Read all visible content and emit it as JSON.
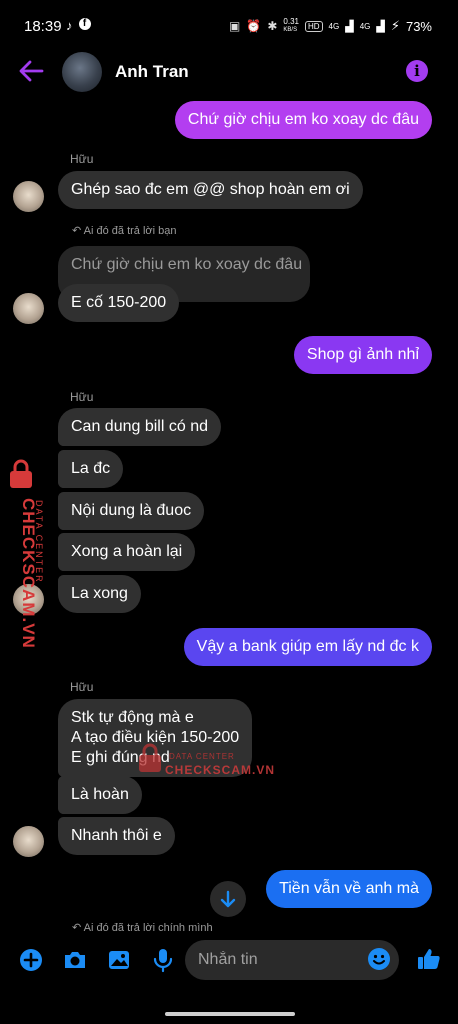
{
  "status_bar": {
    "time": "18:39",
    "speed": "0.31",
    "speed_unit": "KB/S",
    "hd": "HD",
    "net1": "4G",
    "net2": "4G",
    "battery": "73%"
  },
  "header": {
    "contact_name": "Anh Tran"
  },
  "messages": {
    "m1": "Chứ giờ chịu em ko xoay dc đâu",
    "sender1": "Hữu",
    "m2": "Ghép sao đc em @@ shop hoàn em ơi",
    "reply_note1": "Ai đó đã trả lời bạn",
    "quoted1": "Chứ giờ chịu em ko xoay dc đâu",
    "m3": "E cố 150-200",
    "m4": "Shop gì ảnh nhỉ",
    "sender2": "Hữu",
    "m5": "Can dung bill có nd",
    "m6": "La đc",
    "m7": "Nội dung là đuoc",
    "m8": "Xong a hoàn lại",
    "m9": "La xong",
    "m10": "Vậy a bank giúp em lấy nd đc k",
    "sender3": "Hữu",
    "m11_line1": "Stk tự động mà e",
    "m11_line2": "A tạo điều kiện 150-200",
    "m11_line3": "E ghi đúng nd",
    "m12": "Là hoàn",
    "m13": "Nhanh thôi e",
    "m14": "Tiền vẫn về anh mà",
    "reply_note2": "Ai đó đã trả lời chính mình"
  },
  "watermark": {
    "brand": "CHECKSCAM.VN",
    "sub": "DATA CENTER"
  },
  "composer": {
    "placeholder": "Nhắn tin"
  },
  "colors": {
    "accent_purple": "#a33cf0",
    "bubble_purple": "#b33ef0",
    "bubble_violet": "#8a38f2",
    "bubble_indigo": "#5a46f0",
    "bubble_blue": "#1b6ff2",
    "incoming": "#303030",
    "composer_blue": "#1b8cf5"
  }
}
